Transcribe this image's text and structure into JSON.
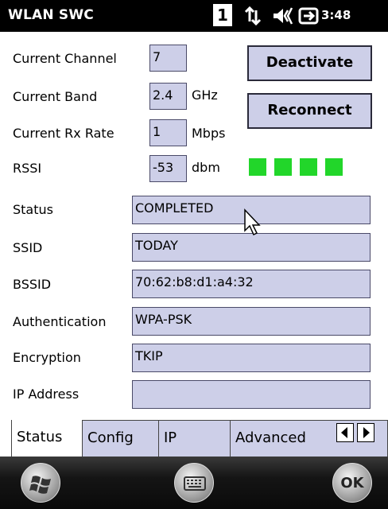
{
  "app_title": "WLAN SWC",
  "tray": {
    "number": "1",
    "time": "3:48",
    "icons": [
      "network-icon",
      "speaker-icon",
      "battery-charging-icon"
    ]
  },
  "fields": {
    "current_channel": {
      "label": "Current Channel",
      "value": "7"
    },
    "current_band": {
      "label": "Current Band",
      "value": "2.4",
      "unit": "GHz"
    },
    "current_rx_rate": {
      "label": "Current Rx Rate",
      "value": "1",
      "unit": "Mbps"
    },
    "rssi": {
      "label": "RSSI",
      "value": "-53",
      "unit": "dbm",
      "signal_bars": 4
    },
    "status": {
      "label": "Status",
      "value": "COMPLETED"
    },
    "ssid": {
      "label": "SSID",
      "value": "TODAY"
    },
    "bssid": {
      "label": "BSSID",
      "value": "70:62:b8:d1:a4:32"
    },
    "authentication": {
      "label": "Authentication",
      "value": "WPA-PSK"
    },
    "encryption": {
      "label": "Encryption",
      "value": "TKIP"
    },
    "ip_address": {
      "label": "IP Address",
      "value": ""
    }
  },
  "buttons": {
    "deactivate": "Deactivate",
    "reconnect": "Reconnect"
  },
  "tabs": [
    {
      "label": "Status",
      "active": true
    },
    {
      "label": "Config",
      "active": false
    },
    {
      "label": "IP",
      "active": false
    },
    {
      "label": "Advanced",
      "active": false
    }
  ],
  "bottom_bar": {
    "ok_label": "OK",
    "icons": [
      "windows-start-icon",
      "keyboard-icon",
      "ok-icon"
    ]
  },
  "colors": {
    "field_bg": "#cdcfe8",
    "signal_green": "#22d62a",
    "bar_black": "#000000"
  }
}
